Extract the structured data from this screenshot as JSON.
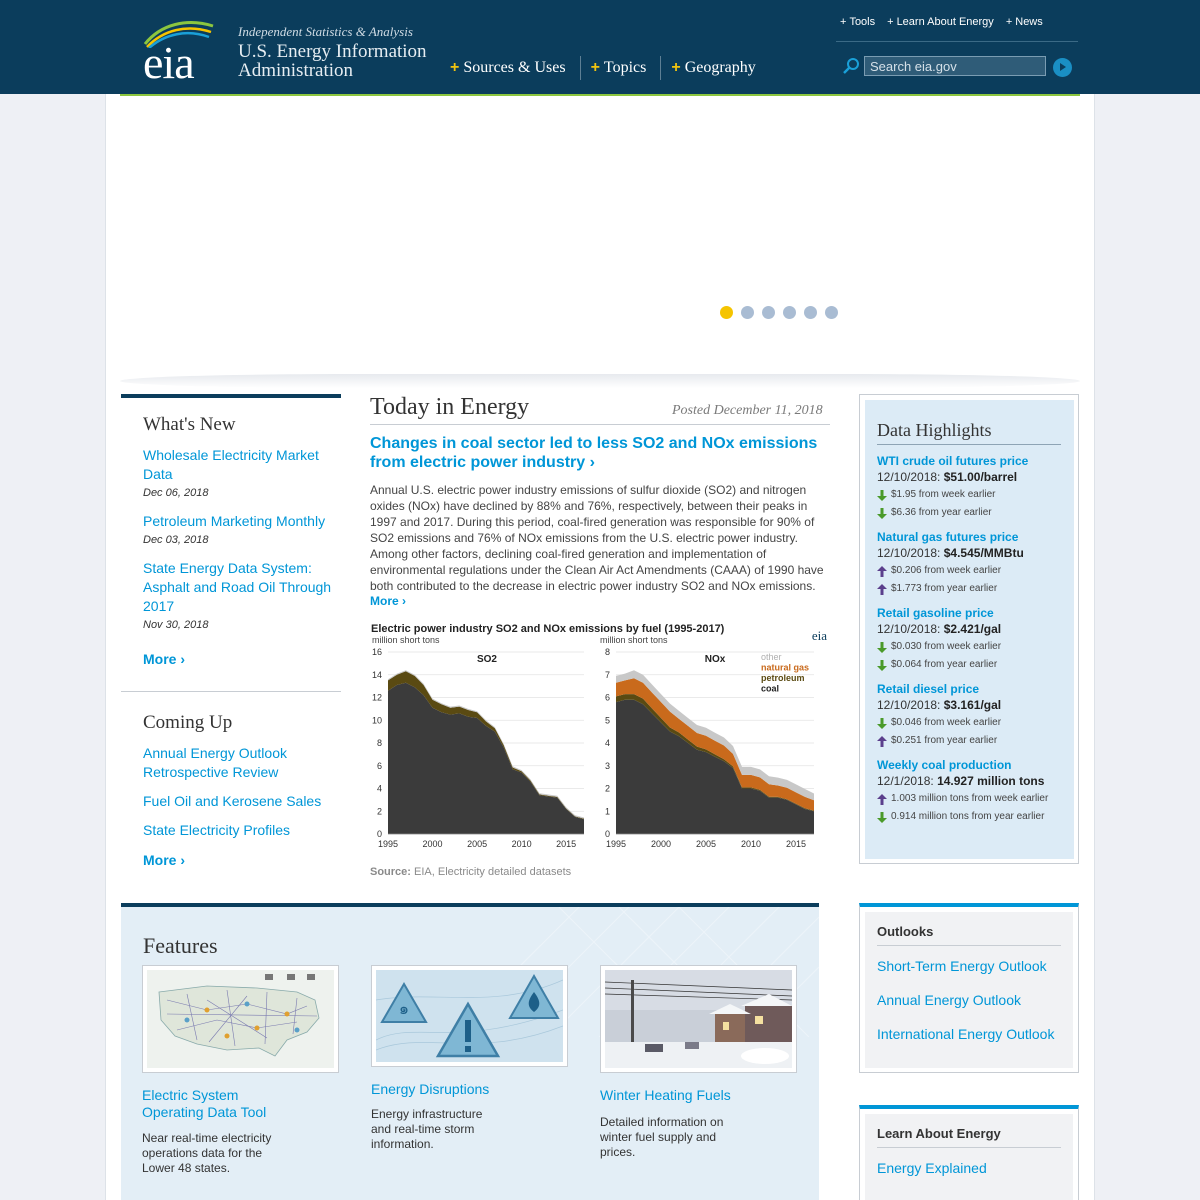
{
  "header": {
    "logo_text": "eia",
    "tagline": "Independent Statistics & Analysis",
    "org_name": "U.S. Energy Information Administration",
    "main_nav": [
      "Sources & Uses",
      "Topics",
      "Geography"
    ],
    "util_nav": [
      "Tools",
      "Learn About Energy",
      "News"
    ],
    "search_placeholder": "Search eia.gov"
  },
  "slider": {
    "dot_count": 6,
    "active_index": 0
  },
  "whats_new": {
    "title": "What's New",
    "items": [
      {
        "title": "Wholesale Electricity Market Data",
        "date": "Dec 06, 2018"
      },
      {
        "title": "Petroleum Marketing Monthly",
        "date": "Dec 03, 2018"
      },
      {
        "title": "State Energy Data System: Asphalt and Road Oil Through 2017",
        "date": "Nov 30, 2018"
      }
    ],
    "more": "More ›"
  },
  "coming_up": {
    "title": "Coming Up",
    "items": [
      "Annual Energy Outlook Retrospective Review",
      "Fuel Oil and Kerosene Sales",
      "State Electricity Profiles"
    ],
    "more": "More ›"
  },
  "today_in_energy": {
    "title": "Today in Energy",
    "posted": "Posted December 11, 2018",
    "headline": "Changes in coal sector led to less SO2 and NOx emissions from electric power industry ›",
    "body": "Annual U.S. electric power industry emissions of sulfur dioxide (SO2) and nitrogen oxides (NOx) have declined by 88% and 76%, respectively, between their peaks in 1997 and 2017. During this period, coal-fired generation was responsible for 90% of SO2 emissions and 76% of NOx emissions from the U.S. electric power industry. Among other factors, declining coal-fired generation and implementation of environmental regulations under the Clean Air Act Amendments (CAAA) of 1990 have both contributed to the decrease in electric power industry SO2 and NOx emissions.",
    "more": "More ›",
    "source_label": "Source:",
    "source_text": "EIA, Electricity detailed datasets"
  },
  "chart_data": {
    "type": "area",
    "title": "Electric power industry SO2 and NOx emissions by fuel (1995-2017)",
    "logo": "eia",
    "series_names": [
      "other",
      "natural gas",
      "petroleum",
      "coal"
    ],
    "colors": {
      "coal": "#3b3b3b",
      "petroleum": "#5a4a12",
      "natural_gas": "#c96a1c",
      "other": "#c8c8c8"
    },
    "x": [
      1995,
      1996,
      1997,
      1998,
      1999,
      2000,
      2001,
      2002,
      2003,
      2004,
      2005,
      2006,
      2007,
      2008,
      2009,
      2010,
      2011,
      2012,
      2013,
      2014,
      2015,
      2016,
      2017
    ],
    "x_ticks": [
      1995,
      2000,
      2005,
      2010,
      2015
    ],
    "panels": [
      {
        "label": "SO2",
        "ylabel": "million short tons",
        "ylim": [
          0,
          16
        ],
        "y_ticks": [
          0,
          2,
          4,
          6,
          8,
          10,
          12,
          14,
          16
        ],
        "coal": [
          12.6,
          13.1,
          13.3,
          12.9,
          12.2,
          11.1,
          10.7,
          10.5,
          10.6,
          10.3,
          10.2,
          9.5,
          9.0,
          7.6,
          5.7,
          5.4,
          4.6,
          3.4,
          3.3,
          3.2,
          2.2,
          1.5,
          1.3
        ],
        "petroleum": [
          0.9,
          0.9,
          1.0,
          1.0,
          0.9,
          0.7,
          0.7,
          0.6,
          0.6,
          0.6,
          0.5,
          0.4,
          0.3,
          0.2,
          0.15,
          0.12,
          0.1,
          0.08,
          0.07,
          0.06,
          0.05,
          0.05,
          0.05
        ],
        "natural_gas": [
          0,
          0,
          0,
          0,
          0,
          0,
          0,
          0,
          0,
          0,
          0,
          0,
          0,
          0,
          0,
          0,
          0,
          0,
          0,
          0,
          0,
          0,
          0
        ],
        "other": [
          0.1,
          0.1,
          0.1,
          0.1,
          0.1,
          0.1,
          0.1,
          0.1,
          0.1,
          0.1,
          0.1,
          0.1,
          0.1,
          0.1,
          0.1,
          0.1,
          0.1,
          0.1,
          0.1,
          0.1,
          0.1,
          0.1,
          0.1
        ]
      },
      {
        "label": "NOx",
        "ylabel": "million short tons",
        "ylim": [
          0,
          8
        ],
        "y_ticks": [
          0,
          1,
          2,
          3,
          4,
          5,
          6,
          7,
          8
        ],
        "coal": [
          5.8,
          5.9,
          5.9,
          5.7,
          5.3,
          4.9,
          4.5,
          4.3,
          4.0,
          3.7,
          3.6,
          3.4,
          3.2,
          2.9,
          2.0,
          2.0,
          1.9,
          1.6,
          1.6,
          1.5,
          1.3,
          1.1,
          1.0
        ],
        "petroleum": [
          0.25,
          0.25,
          0.25,
          0.25,
          0.22,
          0.2,
          0.18,
          0.16,
          0.15,
          0.14,
          0.12,
          0.1,
          0.09,
          0.07,
          0.05,
          0.05,
          0.04,
          0.04,
          0.03,
          0.03,
          0.03,
          0.03,
          0.03
        ],
        "natural_gas": [
          0.6,
          0.6,
          0.7,
          0.7,
          0.7,
          0.7,
          0.7,
          0.6,
          0.6,
          0.6,
          0.6,
          0.6,
          0.6,
          0.55,
          0.55,
          0.55,
          0.55,
          0.55,
          0.5,
          0.5,
          0.5,
          0.5,
          0.45
        ],
        "other": [
          0.3,
          0.3,
          0.35,
          0.35,
          0.35,
          0.35,
          0.35,
          0.35,
          0.35,
          0.35,
          0.35,
          0.35,
          0.35,
          0.35,
          0.35,
          0.35,
          0.35,
          0.35,
          0.35,
          0.35,
          0.35,
          0.35,
          0.3
        ]
      }
    ]
  },
  "data_highlights": {
    "title": "Data Highlights",
    "items": [
      {
        "name": "WTI crude oil futures price",
        "date": "12/10/2018:",
        "value": "$51.00/barrel",
        "changes": [
          {
            "dir": "down",
            "text": "$1.95 from week earlier"
          },
          {
            "dir": "down",
            "text": "$6.36 from year earlier"
          }
        ]
      },
      {
        "name": "Natural gas futures price",
        "date": "12/10/2018:",
        "value": "$4.545/MMBtu",
        "changes": [
          {
            "dir": "up",
            "text": "$0.206 from week earlier"
          },
          {
            "dir": "up",
            "text": "$1.773 from year earlier"
          }
        ]
      },
      {
        "name": "Retail gasoline price",
        "date": "12/10/2018:",
        "value": "$2.421/gal",
        "changes": [
          {
            "dir": "down",
            "text": "$0.030 from week earlier"
          },
          {
            "dir": "down",
            "text": "$0.064 from year earlier"
          }
        ]
      },
      {
        "name": "Retail diesel price",
        "date": "12/10/2018:",
        "value": "$3.161/gal",
        "changes": [
          {
            "dir": "down",
            "text": "$0.046 from week earlier"
          },
          {
            "dir": "up",
            "text": "$0.251 from year earlier"
          }
        ]
      },
      {
        "name": "Weekly coal production",
        "date": "12/1/2018:",
        "value": "14.927 million tons",
        "changes": [
          {
            "dir": "up",
            "text": "1.003 million tons from week earlier"
          },
          {
            "dir": "down",
            "text": "0.914 million tons from year earlier"
          }
        ]
      }
    ]
  },
  "features": {
    "title": "Features",
    "items": [
      {
        "title": "Electric System Operating Data Tool",
        "desc": "Near real-time electricity operations data for the Lower 48 states."
      },
      {
        "title": "Energy Disruptions",
        "desc": "Energy infrastructure and real-time storm information."
      },
      {
        "title": "Winter Heating Fuels",
        "desc": "Detailed information on winter fuel supply and prices."
      }
    ]
  },
  "outlooks": {
    "title": "Outlooks",
    "items": [
      "Short-Term Energy Outlook",
      "Annual Energy Outlook",
      "International Energy Outlook"
    ]
  },
  "learn": {
    "title": "Learn About Energy",
    "items": [
      "Energy Explained"
    ]
  }
}
